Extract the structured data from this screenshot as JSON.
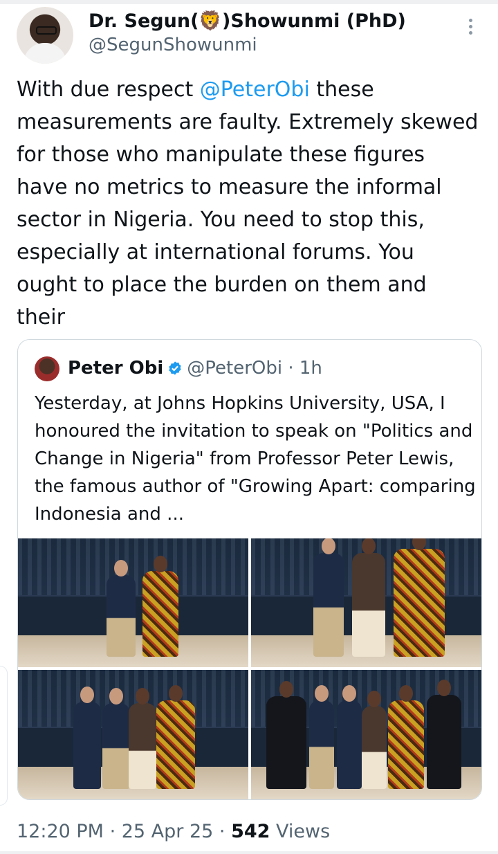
{
  "author": {
    "name_prefix": "Dr. Segun(",
    "name_emoji": "🦁",
    "name_suffix": ")Showunmi (PhD)",
    "handle": "@SegunShowunmi"
  },
  "tweet": {
    "text_before": "With due respect ",
    "mention": "@PeterObi",
    "text_after": " these measurements are faulty. Extremely skewed for those who manipulate these figures have no metrics to measure the informal sector in Nigeria. You need to stop this, especially at international forums. You ought to place the burden on them and their"
  },
  "quote": {
    "name": "Peter Obi",
    "handle": "@PeterObi",
    "separator": " · ",
    "age": "1h",
    "text": "Yesterday, at Johns Hopkins University, USA, I honoured the invitation to speak on \"Politics and Change in Nigeria\" from Professor Peter Lewis, the famous author of \"Growing Apart: comparing Indonesia and ..."
  },
  "meta": {
    "time": "12:20 PM",
    "sep1": " · ",
    "date": "25 Apr 25",
    "sep2": " · ",
    "views_count": "542",
    "views_label": " Views"
  },
  "colors": {
    "accent": "#1d9bf0",
    "text": "#0f1419",
    "muted": "#536471",
    "border": "#cfd9de"
  },
  "icons": {
    "more": "more-vertical-icon",
    "verified": "verified-badge-icon"
  }
}
